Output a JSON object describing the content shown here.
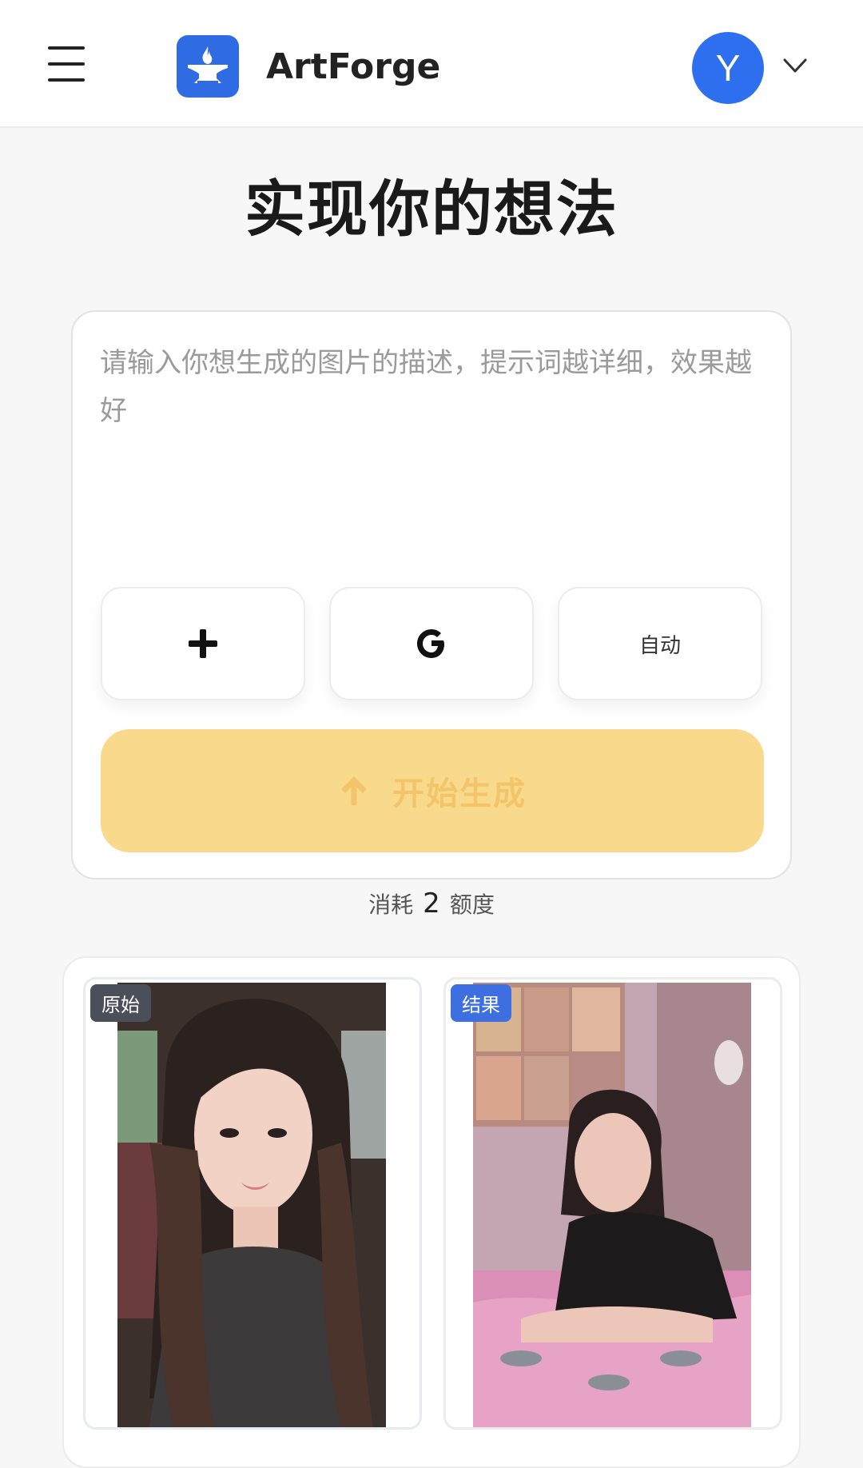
{
  "header": {
    "brand": "ArtForge",
    "avatar_initial": "Y",
    "colors": {
      "logo": "#2f6be3",
      "avatar": "#2e6ff0"
    },
    "icons": {
      "menu": "hamburger-menu-icon",
      "logo": "anvil-flame-icon",
      "dropdown": "chevron-down-icon"
    }
  },
  "main": {
    "title": "实现你的想法",
    "prompt": {
      "placeholder": "请输入你想生成的图片的描述，提示词越详细，效果越好",
      "value": ""
    },
    "options": [
      {
        "label": "+",
        "icon": "plus-icon"
      },
      {
        "label": "G",
        "icon": "google-icon"
      },
      {
        "label": "自动"
      }
    ],
    "generate": {
      "label": "开始生成",
      "icon": "arrow-up-icon",
      "color": "#f9d98b"
    },
    "cost": {
      "prefix": "消耗",
      "amount": "2",
      "suffix": "额度"
    }
  },
  "showcase": {
    "original_label": "原始",
    "result_label": "结果"
  }
}
